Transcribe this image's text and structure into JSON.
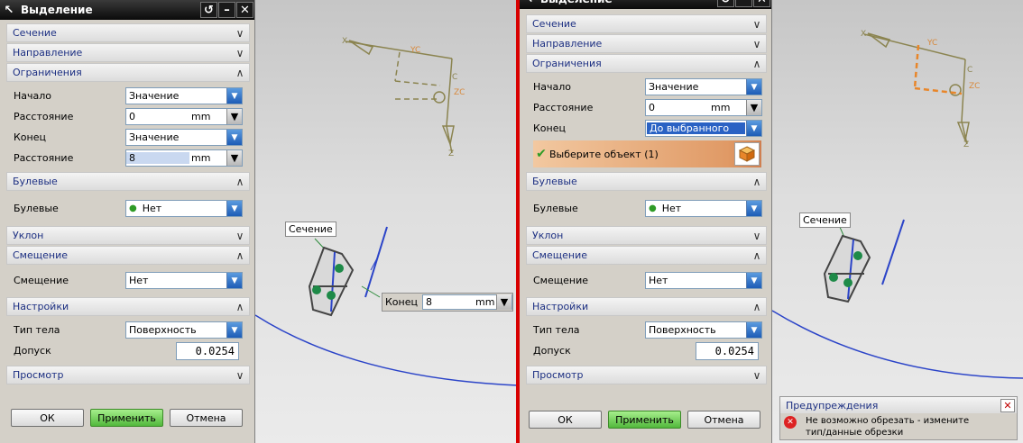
{
  "dialog_title": "Выделение",
  "title_icon": "arrow-icon",
  "title_buttons": {
    "reset": "↺",
    "minimize": "–",
    "close": "✕"
  },
  "sections": {
    "section": "Сечение",
    "direction": "Направление",
    "limits": "Ограничения",
    "boolean": "Булевые",
    "draft": "Уклон",
    "offset": "Смещение",
    "settings": "Настройки",
    "preview": "Просмотр"
  },
  "fields": {
    "start_label": "Начало",
    "distance_label": "Расстояние",
    "end_label": "Конец",
    "boolean_label": "Булевые",
    "offset_label": "Смещение",
    "body_type_label": "Тип тела",
    "tolerance_label": "Допуск"
  },
  "left": {
    "start_value": "Значение",
    "start_distance": "0",
    "end_value": "Значение",
    "end_distance": "8",
    "unit": "mm",
    "boolean_value": "Нет",
    "offset_value": "Нет",
    "body_type_value": "Поверхность",
    "tolerance_value": "0.0254"
  },
  "right": {
    "start_value": "Значение",
    "start_distance": "0",
    "end_value": "До выбранного",
    "unit": "mm",
    "select_object": "Выберите объект (1)",
    "boolean_value": "Нет",
    "offset_value": "Нет",
    "body_type_value": "Поверхность",
    "tolerance_value": "0.0254"
  },
  "buttons": {
    "ok": "ОК",
    "apply": "Применить",
    "cancel": "Отмена"
  },
  "viewport": {
    "section_label": "Сечение",
    "end_label": "Конец",
    "end_value": "8",
    "end_unit": "mm",
    "axis_labels": [
      "X",
      "YC",
      "C",
      "ZC",
      "Z"
    ]
  },
  "warning": {
    "title": "Предупреждения",
    "message": "Не возможно обрезать - измените\nтип/данные обрезки"
  },
  "colors": {
    "accent_blue": "#1c2f82",
    "apply_green": "#52b83c",
    "divider_red": "#d80000",
    "axis_khaki": "#8b8450"
  }
}
